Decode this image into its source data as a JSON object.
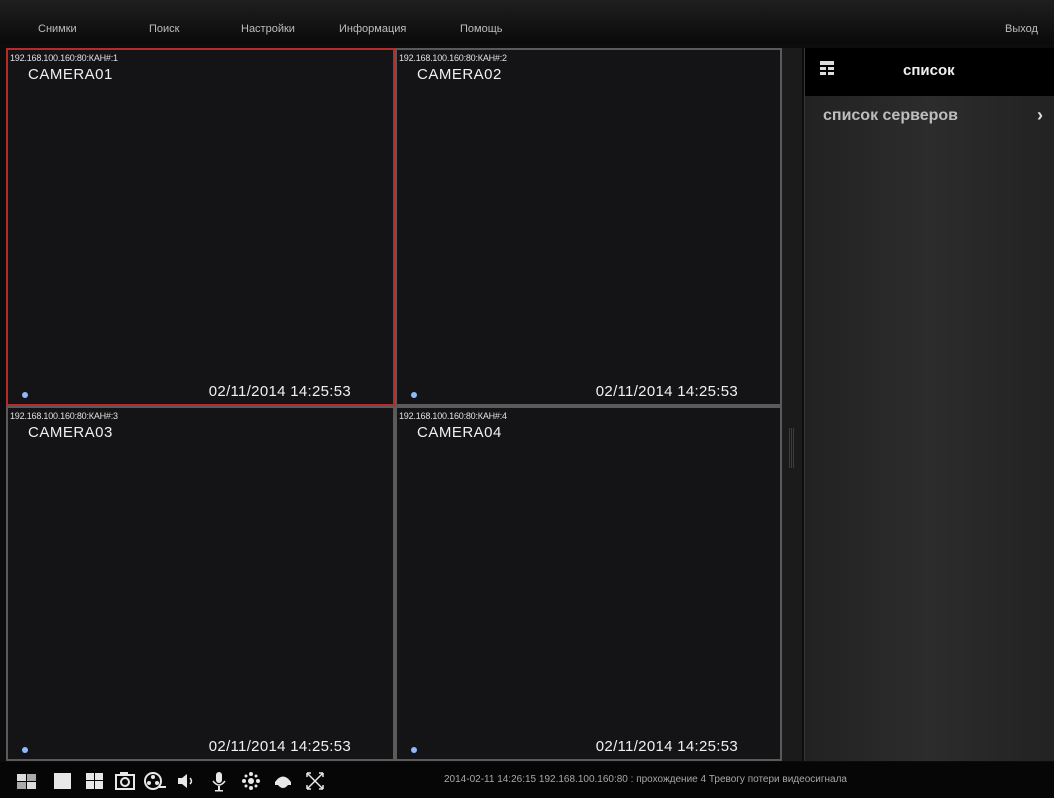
{
  "menu": {
    "items": [
      "Снимки",
      "Поиск",
      "Настройки",
      "Информация",
      "Помощь"
    ],
    "exit_label": "Выход"
  },
  "cameras": [
    {
      "channel": "192.168.100.160:80:КАН#:1",
      "name": "CAMERA01",
      "timestamp": "02/11/2014 14:25:53",
      "selected": true
    },
    {
      "channel": "192.168.100.160:80:КАН#:2",
      "name": "CAMERA02",
      "timestamp": "02/11/2014 14:25:53",
      "selected": false
    },
    {
      "channel": "192.168.100.160:80:КАН#:3",
      "name": "CAMERA03",
      "timestamp": "02/11/2014 14:25:53",
      "selected": false
    },
    {
      "channel": "192.168.100.160:80:КАН#:4",
      "name": "CAMERA04",
      "timestamp": "02/11/2014 14:25:53",
      "selected": false
    }
  ],
  "panel": {
    "title": "список",
    "items": [
      {
        "label": "список серверов",
        "icon": "chevron-right-icon"
      }
    ]
  },
  "toolbar": {
    "tools": [
      "layout-1x1-small-icon",
      "single-view-icon",
      "quad-view-icon",
      "snapshot-icon",
      "record-icon",
      "audio-icon",
      "microphone-icon",
      "ptz-settings-icon",
      "ptz-dome-icon",
      "fullscreen-icon"
    ],
    "status_text": "2014-02-11 14:26:15 192.168.100.160:80 : прохождение 4 Тревогу потери видеосигнала"
  },
  "colors": {
    "selected_border": "#b52a2a",
    "cell_border": "#5a5a5a",
    "cell_background": "#141417"
  }
}
